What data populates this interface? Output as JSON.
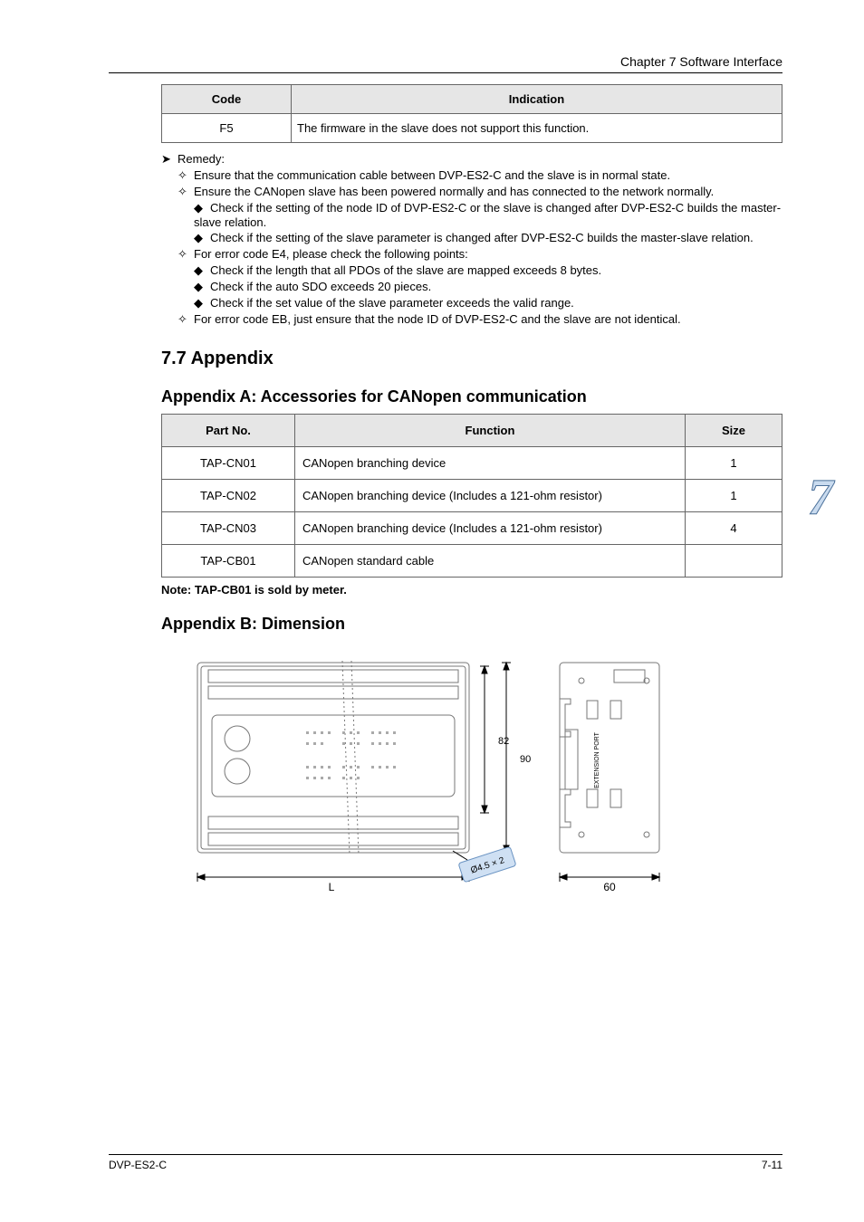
{
  "header": {
    "title": "Chapter 7 Software Interface"
  },
  "footer": {
    "left": "DVP-ES2-C",
    "right": "7-11"
  },
  "firstTable": {
    "header": [
      "Code",
      "Indication"
    ],
    "rows": [
      [
        "F5",
        "The firmware in the slave does not support this function."
      ]
    ]
  },
  "bullets": [
    {
      "lvl": 0,
      "marker": "➤",
      "text": "Remedy:"
    },
    {
      "lvl": 1,
      "marker": "✧",
      "text": "Ensure that the communication cable between DVP-ES2-C and the slave is in normal state."
    },
    {
      "lvl": 1,
      "marker": "✧",
      "text": "Ensure the CANopen slave has been powered normally and has connected to the network normally."
    },
    {
      "lvl": 2,
      "marker": "◆",
      "text": "Check if the setting of the node ID of DVP-ES2-C or the slave is changed after DVP-ES2-C builds the master-slave relation."
    },
    {
      "lvl": 2,
      "marker": "◆",
      "text": "Check if the setting of the slave parameter is changed after DVP-ES2-C builds the master-slave relation."
    },
    {
      "lvl": 1,
      "marker": "✧",
      "text": "For error code E4, please check the following points:"
    },
    {
      "lvl": 2,
      "marker": "◆",
      "text": "Check if the length that all PDOs of the slave are mapped exceeds 8 bytes."
    },
    {
      "lvl": 2,
      "marker": "◆",
      "text": "Check if the auto SDO exceeds 20 pieces."
    },
    {
      "lvl": 2,
      "marker": "◆",
      "text": "Check if the set value of the slave parameter exceeds the valid range."
    },
    {
      "lvl": 1,
      "marker": "✧",
      "text": "For error code EB, just ensure that the node ID of DVP-ES2-C and the slave are not identical."
    }
  ],
  "appendixTitle": "7.7 Appendix",
  "appendixBTitle": "Appendix B: Dimension",
  "partsTable": {
    "title": "Appendix A: Accessories for CANopen communication",
    "headers": [
      "Part No.",
      "Function",
      "Size"
    ],
    "rows": [
      [
        "TAP-CN01",
        "CANopen branching device",
        "1"
      ],
      [
        "TAP-CN02",
        "CANopen branching device (Includes a 121-ohm resistor)",
        "1"
      ],
      [
        "TAP-CN03",
        "CANopen branching device (Includes a 121-ohm resistor)",
        "4"
      ],
      [
        "TAP-CB01",
        "CANopen standard cable",
        ""
      ]
    ]
  },
  "note": "Note: TAP-CB01 is sold by meter.",
  "diagram": {
    "L_label": "L",
    "W_label": "82",
    "H_label": "90",
    "depth_label": "60",
    "hole_label": "Ø4.5 × 2",
    "side_note": "EXTENSION PORT"
  },
  "decor": {
    "bigDigit": "7"
  }
}
